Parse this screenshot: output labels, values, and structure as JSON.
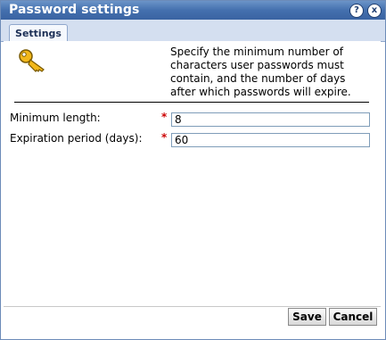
{
  "window": {
    "title": "Password settings",
    "help_icon": "?",
    "close_icon": "x"
  },
  "tabs": [
    {
      "label": "Settings",
      "active": true
    }
  ],
  "description": "Specify the minimum number of characters user passwords must contain, and the number of days after which passwords will expire.",
  "fields": [
    {
      "label": "Minimum length:",
      "required_mark": "*",
      "value": "8"
    },
    {
      "label": "Expiration period (days):",
      "required_mark": "*",
      "value": "60"
    }
  ],
  "buttons": {
    "save": "Save",
    "cancel": "Cancel"
  },
  "colors": {
    "titlebar": "#4470ae",
    "required": "#cc0000",
    "key_icon": "#f2b81b"
  }
}
